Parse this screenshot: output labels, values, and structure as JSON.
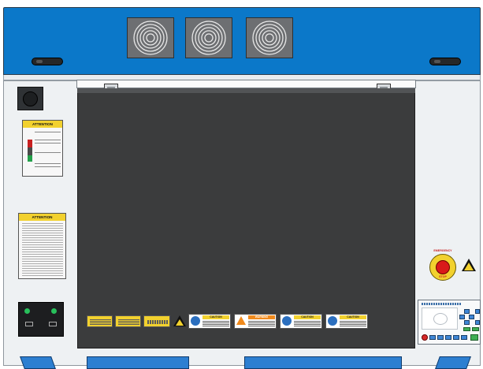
{
  "machine": {
    "colors": {
      "top_panel": "#0b78c9",
      "lid": "#3b3c3d",
      "body": "#eef1f3",
      "feet": "#2d7fd1",
      "warning_yellow": "#f2d12e",
      "estop_red": "#d91a1a"
    }
  },
  "top_vents": {
    "count": 3,
    "icon": "fan-grille-icon"
  },
  "left_panel": {
    "attention_label_1": {
      "title": "ATTENTION"
    },
    "attention_label_2": {
      "title": "ATTENTION"
    },
    "power_panel": {
      "icon": "power-socket-icon"
    }
  },
  "lid_stickers": [
    {
      "kind": "yellow-text",
      "title": ""
    },
    {
      "kind": "yellow-text",
      "title": ""
    },
    {
      "kind": "yellow-text",
      "title": ""
    },
    {
      "kind": "laser-warning-triangle",
      "title": ""
    },
    {
      "kind": "caution-manual",
      "title": "CAUTION"
    },
    {
      "kind": "warning",
      "title": "WARNING"
    },
    {
      "kind": "caution-eye",
      "title": "CAUTION"
    },
    {
      "kind": "caution-hand",
      "title": "CAUTION"
    }
  ],
  "right_panel": {
    "emergency_stop": {
      "label_top": "EMERGENCY",
      "label_bottom": "STOP"
    },
    "control_panel": {
      "header": ""
    }
  }
}
